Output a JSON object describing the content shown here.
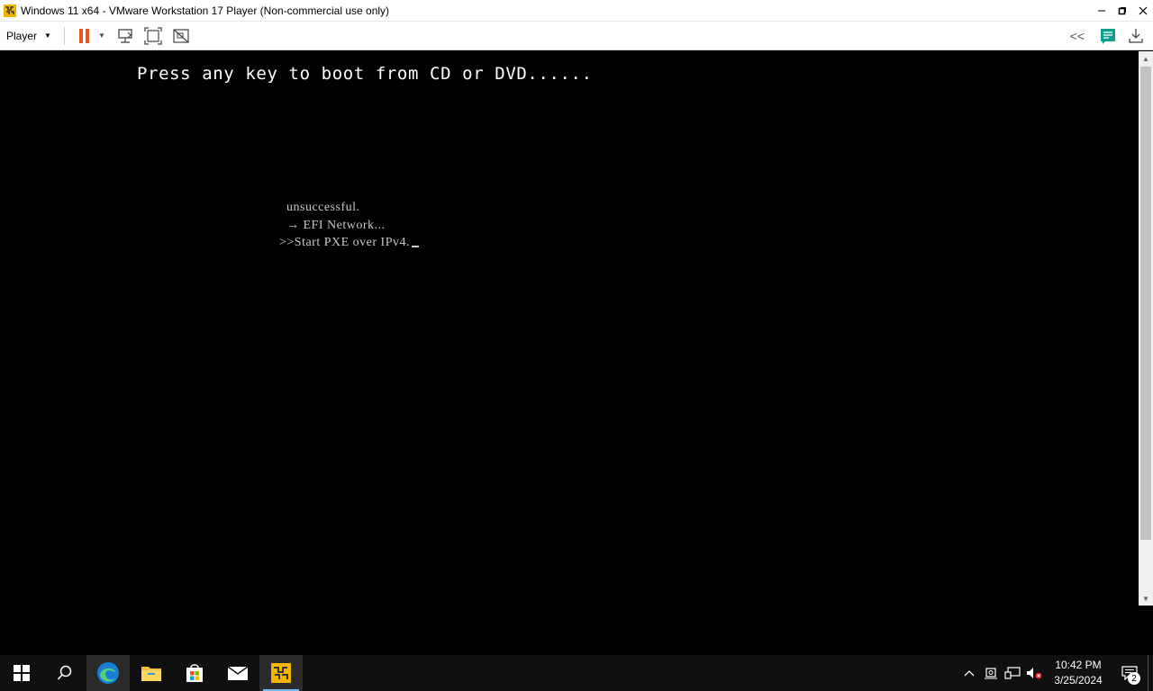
{
  "window": {
    "title": "Windows 11 x64 - VMware Workstation 17 Player (Non-commercial use only)",
    "controls": [
      "minimize",
      "restore",
      "close"
    ]
  },
  "toolbar": {
    "player_label": "Player",
    "icons": [
      "pause-icon",
      "send-ctrl-alt-del-icon",
      "full-screen-icon",
      "unity-icon"
    ],
    "right_icons": [
      "collapse-icon",
      "message-log-icon",
      "removable-devices-icon"
    ],
    "collapse_glyph": "<<"
  },
  "console": {
    "boot_prompt": "Press any key to boot from CD or DVD......",
    "lines": [
      "unsuccessful.",
      "→ EFI Network...",
      ">>Start PXE over IPv4."
    ]
  },
  "taskbar": {
    "items": [
      "start-icon",
      "search-icon",
      "edge-icon",
      "file-explorer-icon",
      "store-icon",
      "mail-icon",
      "vmware-player-icon"
    ],
    "clock": {
      "time": "10:42 PM",
      "date": "3/25/2024"
    },
    "tray_icons": [
      "chevron-up-icon",
      "meet-now-icon",
      "network-icon",
      "volume-muted-icon"
    ],
    "notification_count": "2"
  },
  "colors": {
    "pause": "#e8581c",
    "console_bg": "#000000",
    "taskbar_bg": "#101010",
    "running_indicator": "#76b9ed"
  }
}
